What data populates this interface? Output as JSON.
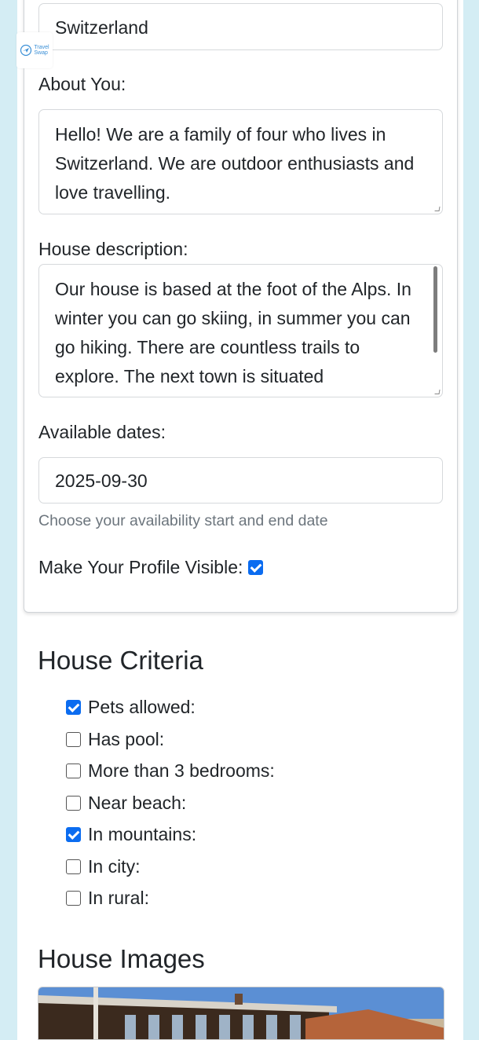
{
  "logo": {
    "line1": "Travel",
    "line2": "Swap"
  },
  "profile": {
    "country_value": "Switzerland",
    "about_label": "About You:",
    "about_value": "Hello! We are a family of four who lives in Switzerland. We are outdoor enthusiasts and love travelling.",
    "house_label": "House description:",
    "house_value": "Our house is based at the foot of the Alps. In winter you can go skiing, in summer you can go hiking. There are countless trails to explore. The next town is situated",
    "dates_label": "Available dates:",
    "date_value": "2025-09-30",
    "dates_help": "Choose your availability start and end date",
    "visible_label": "Make Your Profile Visible:",
    "visible_checked": true
  },
  "criteria": {
    "title": "House Criteria",
    "items": [
      {
        "label": "Pets allowed:",
        "checked": true
      },
      {
        "label": "Has pool:",
        "checked": false
      },
      {
        "label": "More than 3 bedrooms:",
        "checked": false
      },
      {
        "label": "Near beach:",
        "checked": false
      },
      {
        "label": "In mountains:",
        "checked": true
      },
      {
        "label": "In city:",
        "checked": false
      },
      {
        "label": "In rural:",
        "checked": false
      }
    ]
  },
  "images": {
    "title": "House Images"
  },
  "colors": {
    "accent": "#0b6cf0",
    "side_bg": "#d4edf4",
    "help_text": "#6c757d"
  }
}
